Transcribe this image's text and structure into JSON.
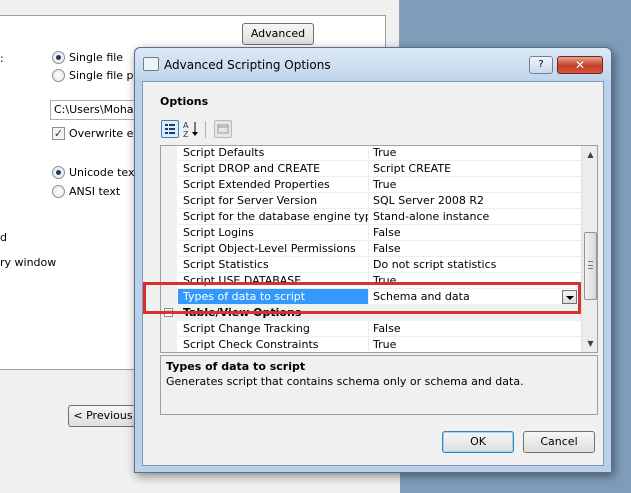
{
  "background_wizard": {
    "advanced_button": "Advanced",
    "left_fragments": [
      ":",
      "d",
      "ry window"
    ],
    "single_file": "Single file",
    "single_file_per": "Single file per",
    "path_value": "C:\\Users\\Moham",
    "overwrite": "Overwrite exi",
    "unicode_text": "Unicode text",
    "ansi_text": "ANSI text",
    "previous_button": "< Previous"
  },
  "dialog": {
    "title": "Advanced Scripting Options",
    "help_glyph": "?",
    "close_glyph": "✕",
    "options_label": "Options",
    "properties": [
      {
        "name": "Script Defaults",
        "value": "True"
      },
      {
        "name": "Script DROP and CREATE",
        "value": "Script CREATE"
      },
      {
        "name": "Script Extended Properties",
        "value": "True"
      },
      {
        "name": "Script for Server Version",
        "value": "SQL Server 2008 R2"
      },
      {
        "name": "Script for the database engine type",
        "value": "Stand-alone instance"
      },
      {
        "name": "Script Logins",
        "value": "False"
      },
      {
        "name": "Script Object-Level Permissions",
        "value": "False"
      },
      {
        "name": "Script Statistics",
        "value": "Do not script statistics"
      },
      {
        "name": "Script USE DATABASE",
        "value": "True"
      },
      {
        "name": "Types of data to script",
        "value": "Schema and data",
        "selected": true
      },
      {
        "name": "Table/View Options",
        "category": true
      },
      {
        "name": "Script Change Tracking",
        "value": "False"
      },
      {
        "name": "Script Check Constraints",
        "value": "True"
      }
    ],
    "description": {
      "title": "Types of data to script",
      "text": "Generates script that contains schema only or schema and data."
    },
    "ok_button": "OK",
    "cancel_button": "Cancel"
  },
  "colors": {
    "selection": "#3399ff",
    "highlight_border": "#d9312a"
  }
}
